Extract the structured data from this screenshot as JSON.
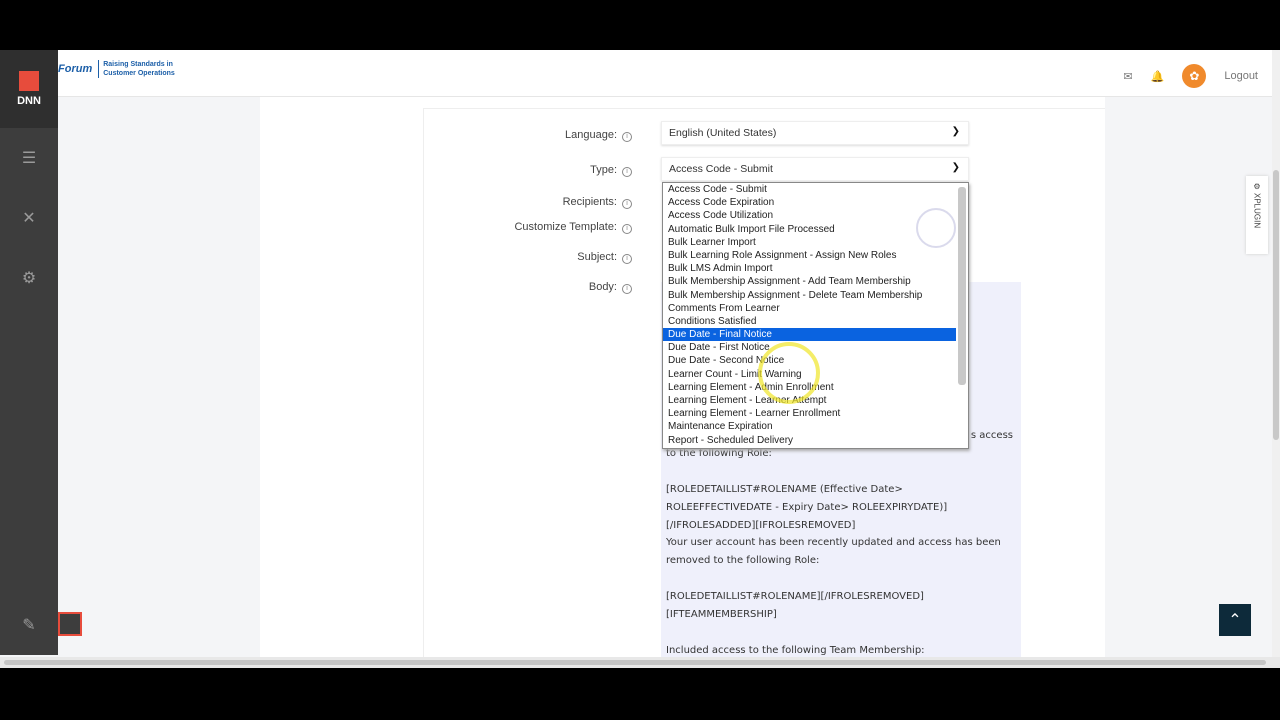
{
  "header": {
    "brand_name": "Forum",
    "brand_tagline_1": "Raising Standards in",
    "brand_tagline_2": "Customer Operations",
    "logout": "Logout"
  },
  "sidebar": {
    "logo_text": "DNN"
  },
  "form": {
    "language_label": "Language:",
    "language_value": "English (United States)",
    "type_label": "Type:",
    "type_value": "Access Code - Submit",
    "recipients_label": "Recipients:",
    "customize_label": "Customize Template:",
    "subject_label": "Subject:",
    "body_label": "Body:",
    "info_glyph": "i"
  },
  "dropdown": {
    "selected_index": 11,
    "options": [
      "Access Code - Submit",
      "Access Code Expiration",
      "Access Code Utilization",
      "Automatic Bulk Import File Processed",
      "Bulk Learner Import",
      "Bulk Learning Role Assignment - Assign New Roles",
      "Bulk LMS Admin Import",
      "Bulk Membership Assignment - Add Team Membership",
      "Bulk Membership Assignment - Delete Team Membership",
      "Comments From Learner",
      "Conditions Satisfied",
      "Due Date - Final Notice",
      "Due Date - First Notice",
      "Due Date - Second Notice",
      "Learner Count - Limit Warning",
      "Learning Element - Admin Enrollment",
      "Learning Element - Learner Attempt",
      "Learning Element - Learner Enrollment",
      "Maintenance Expiration",
      "Report - Scheduled Delivery"
    ]
  },
  "body_lines": [
    "s access",
    "to the following Role:",
    "",
    "[ROLEDETAILLIST#ROLENAME (Effective Date>",
    "ROLEEFFECTIVEDATE - Expiry Date> ROLEEXPIRYDATE)]",
    "[/IFROLESADDED][IFROLESREMOVED]",
    "Your user account has been recently updated and access has been",
    "removed to the following Role:",
    "",
    "[ROLEDETAILLIST#ROLENAME][/IFROLESREMOVED]",
    "[IFTEAMMEMBERSHIP]",
    "",
    "Included access to the following Team Membership:"
  ],
  "plugin_label": "XPLUGIN"
}
